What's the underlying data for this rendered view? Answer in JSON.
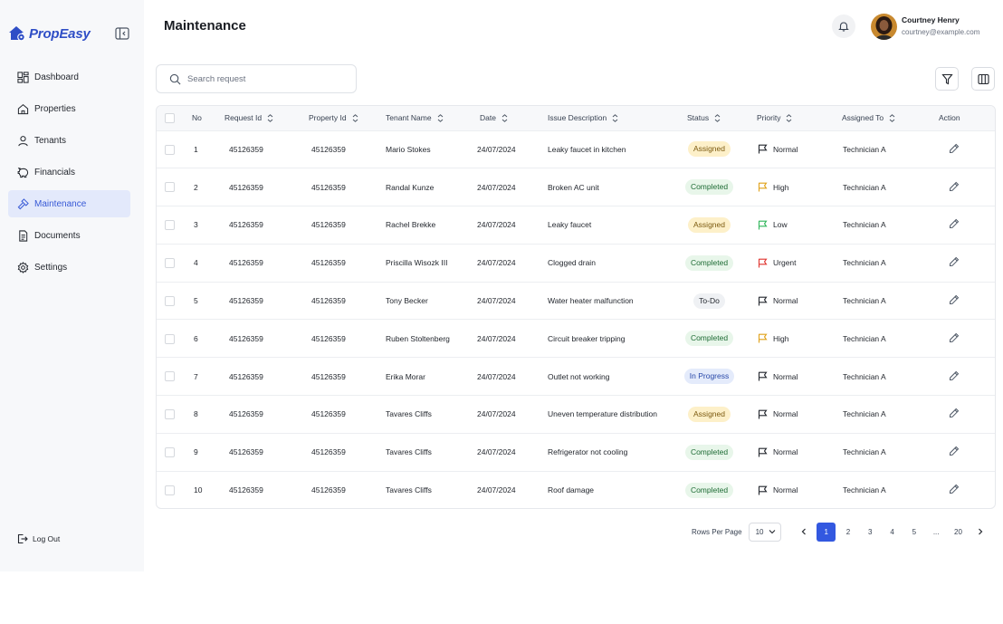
{
  "brand": {
    "name": "PropEasy"
  },
  "sidebar": {
    "items": [
      {
        "label": "Dashboard",
        "icon": "dashboard-icon"
      },
      {
        "label": "Properties",
        "icon": "home-icon"
      },
      {
        "label": "Tenants",
        "icon": "user-icon"
      },
      {
        "label": "Financials",
        "icon": "piggy-bank-icon"
      },
      {
        "label": "Maintenance",
        "icon": "hammer-icon",
        "active": true
      },
      {
        "label": "Documents",
        "icon": "document-icon"
      },
      {
        "label": "Settings",
        "icon": "gear-icon"
      }
    ],
    "logout": "Log Out"
  },
  "header": {
    "title": "Maintenance",
    "user": {
      "name": "Courtney Henry",
      "email": "courtney@example.com"
    }
  },
  "search": {
    "placeholder": "Search request",
    "value": ""
  },
  "table": {
    "columns": [
      "No",
      "Request Id",
      "Property Id",
      "Tenant Name",
      "Date",
      "Issue Description",
      "Status",
      "Priority",
      "Assigned To",
      "Action"
    ],
    "rows": [
      {
        "no": "1",
        "request_id": "45126359",
        "property_id": "45126359",
        "tenant": "Mario Stokes",
        "date": "24/07/2024",
        "issue": "Leaky faucet in kitchen",
        "status": "Assigned",
        "priority": "Normal",
        "assigned": "Technician A"
      },
      {
        "no": "2",
        "request_id": "45126359",
        "property_id": "45126359",
        "tenant": "Randal Kunze",
        "date": "24/07/2024",
        "issue": "Broken AC unit",
        "status": "Completed",
        "priority": "High",
        "assigned": "Technician A"
      },
      {
        "no": "3",
        "request_id": "45126359",
        "property_id": "45126359",
        "tenant": "Rachel Brekke",
        "date": "24/07/2024",
        "issue": "Leaky faucet",
        "status": "Assigned",
        "priority": "Low",
        "assigned": "Technician A"
      },
      {
        "no": "4",
        "request_id": "45126359",
        "property_id": "45126359",
        "tenant": "Priscilla Wisozk III",
        "date": "24/07/2024",
        "issue": "Clogged drain",
        "status": "Completed",
        "priority": "Urgent",
        "assigned": "Technician A"
      },
      {
        "no": "5",
        "request_id": "45126359",
        "property_id": "45126359",
        "tenant": "Tony Becker",
        "date": "24/07/2024",
        "issue": "Water heater malfunction",
        "status": "To-Do",
        "priority": "Normal",
        "assigned": "Technician A"
      },
      {
        "no": "6",
        "request_id": "45126359",
        "property_id": "45126359",
        "tenant": "Ruben Stoltenberg",
        "date": "24/07/2024",
        "issue": "Circuit breaker tripping",
        "status": "Completed",
        "priority": "High",
        "assigned": "Technician A"
      },
      {
        "no": "7",
        "request_id": "45126359",
        "property_id": "45126359",
        "tenant": "Erika Morar",
        "date": "24/07/2024",
        "issue": "Outlet not working",
        "status": "In Progress",
        "priority": "Normal",
        "assigned": "Technician A"
      },
      {
        "no": "8",
        "request_id": "45126359",
        "property_id": "45126359",
        "tenant": "Tavares Cliffs",
        "date": "24/07/2024",
        "issue": "Uneven temperature distribution",
        "status": "Assigned",
        "priority": "Normal",
        "assigned": "Technician A"
      },
      {
        "no": "9",
        "request_id": "45126359",
        "property_id": "45126359",
        "tenant": "Tavares Cliffs",
        "date": "24/07/2024",
        "issue": "Refrigerator not cooling",
        "status": "Completed",
        "priority": "Normal",
        "assigned": "Technician A"
      },
      {
        "no": "10",
        "request_id": "45126359",
        "property_id": "45126359",
        "tenant": "Tavares Cliffs",
        "date": "24/07/2024",
        "issue": "Roof damage",
        "status": "Completed",
        "priority": "Normal",
        "assigned": "Technician A"
      }
    ]
  },
  "colors": {
    "accent": "#3358e0",
    "priority": {
      "Normal": "#23272e",
      "High": "#e0a21a",
      "Low": "#2fb55a",
      "Urgent": "#e0342f"
    }
  },
  "pagination": {
    "rows_per_page_label": "Rows Per Page",
    "rows_per_page": "10",
    "pages": [
      "1",
      "2",
      "3",
      "4",
      "5",
      "...",
      "20"
    ],
    "current": "1"
  }
}
